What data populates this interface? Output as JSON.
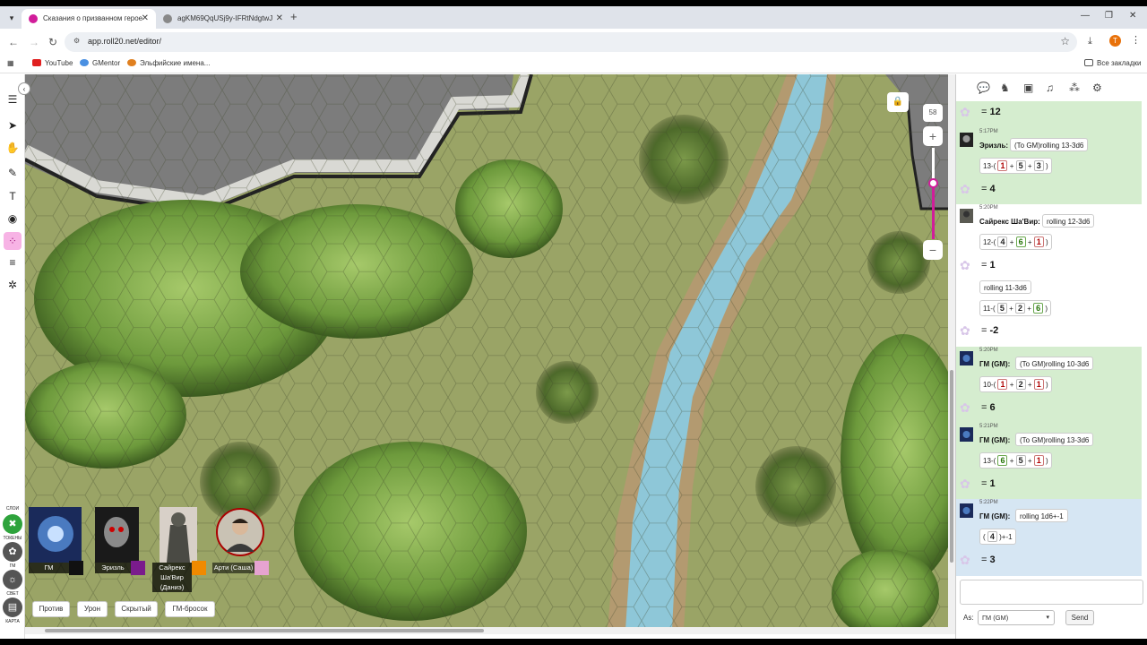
{
  "browser": {
    "tabs": [
      {
        "title": "Сказания о призванном герое",
        "active": true,
        "favicon_color": "#d11d9a"
      },
      {
        "title": "agKM69QqUSj9y-IFRtNdgtwJ",
        "active": false,
        "favicon_color": "#888888"
      }
    ],
    "new_tab": "+",
    "url": "app.roll20.net/editor/",
    "bookmarks": [
      {
        "label": "YouTube",
        "icon": "youtube-icon",
        "color": "#e02020"
      },
      {
        "label": "GMentor",
        "icon": "gmentor-icon",
        "color": "#4a90e2"
      },
      {
        "label": "Эльфийские имена...",
        "icon": "elf-names-icon",
        "color": "#e08020"
      }
    ],
    "all_bookmarks": "Все закладки",
    "profile_initial": "T"
  },
  "toolbar": {
    "layer_labels": {
      "tokens_top": "СЛОИ",
      "tokens": "ТОКЕНЫ",
      "gm": "ГМ",
      "light": "СВЕТ",
      "map": "КАРТА"
    }
  },
  "map": {
    "zoom": "58",
    "zoom_level": 0.62,
    "zoom_plus": "+",
    "zoom_minus": "−"
  },
  "players": [
    {
      "name": "ГМ",
      "color": "#111111"
    },
    {
      "name": "Эризль",
      "color": "#7a1b8c"
    },
    {
      "name": "Сайрекс Ша'Вир (Даниэ)",
      "color": "#f08a00"
    },
    {
      "name": "Арти (Саша)",
      "color": "#e6a3d0"
    }
  ],
  "macros": [
    "Против",
    "Урон",
    "Скрытый",
    "ГМ-бросок"
  ],
  "chat": {
    "messages": [
      {
        "result": "12"
      },
      {
        "time": "5:17PM",
        "who": "Эризль:",
        "roll": "(To GM)rolling 13-3d6",
        "base": "13-(",
        "dice": [
          {
            "v": "1",
            "c": "lo"
          },
          {
            "v": "5",
            "c": ""
          },
          {
            "v": "3",
            "c": ""
          }
        ],
        "result": "4"
      },
      {
        "time": "5:20PM",
        "who": "Сайрекс Ша'Вир:",
        "roll": "rolling 12-3d6",
        "base": "12-(",
        "dice": [
          {
            "v": "4",
            "c": ""
          },
          {
            "v": "6",
            "c": "hi"
          },
          {
            "v": "1",
            "c": "lo"
          }
        ],
        "result": "1"
      },
      {
        "roll": "rolling 11-3d6",
        "base": "11-(",
        "dice": [
          {
            "v": "5",
            "c": ""
          },
          {
            "v": "2",
            "c": ""
          },
          {
            "v": "6",
            "c": "hi"
          }
        ],
        "result": "-2"
      },
      {
        "time": "5:20PM",
        "who": "ГМ (GM):",
        "roll": "(To GM)rolling 10-3d6",
        "base": "10-(",
        "dice": [
          {
            "v": "1",
            "c": "lo"
          },
          {
            "v": "2",
            "c": ""
          },
          {
            "v": "1",
            "c": "lo"
          }
        ],
        "result": "6"
      },
      {
        "time": "5:21PM",
        "who": "ГМ (GM):",
        "roll": "(To GM)rolling 13-3d6",
        "base": "13-(",
        "dice": [
          {
            "v": "6",
            "c": "hi"
          },
          {
            "v": "5",
            "c": ""
          },
          {
            "v": "1",
            "c": "lo"
          }
        ],
        "result": "1"
      },
      {
        "time": "5:22PM",
        "who": "ГМ (GM):",
        "roll": "rolling 1d6+-1",
        "base": "(",
        "dice": [
          {
            "v": "4",
            "c": ""
          }
        ],
        "suffix": ")+-1",
        "result": "3"
      }
    ],
    "close_paren": ")",
    "plus": "+",
    "equals": "=",
    "as_label": "As:",
    "as_value": "ГМ (GM)",
    "send": "Send"
  }
}
